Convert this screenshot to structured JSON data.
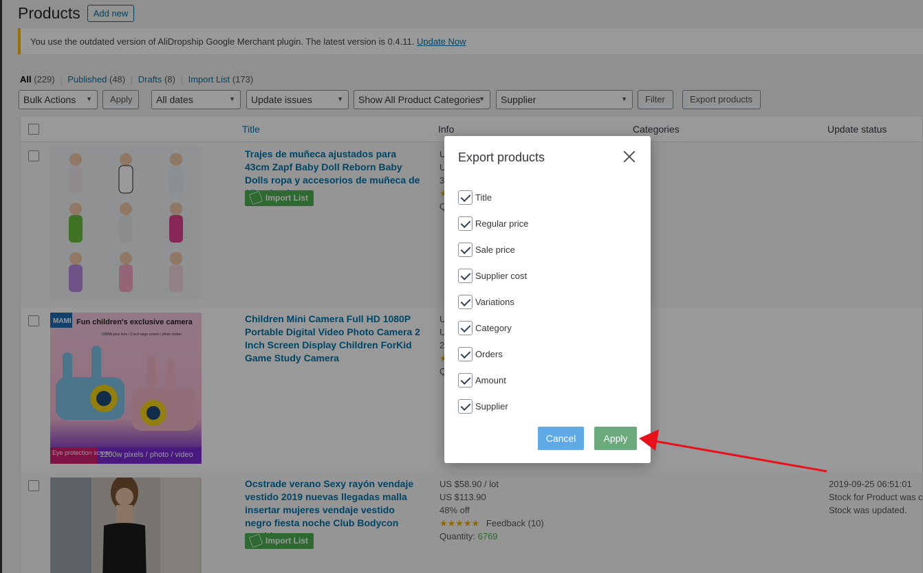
{
  "header": {
    "title": "Products",
    "add_new": "Add new"
  },
  "notice": {
    "text": "You use the outdated version of AliDropship Google Merchant plugin. The latest version is 0.4.11.",
    "link": "Update Now"
  },
  "views": [
    {
      "label": "All",
      "count": "(229)"
    },
    {
      "label": "Published",
      "count": "(48)"
    },
    {
      "label": "Drafts",
      "count": "(8)"
    },
    {
      "label": "Import List",
      "count": "(173)"
    }
  ],
  "filters": {
    "bulk_actions": "Bulk Actions",
    "apply": "Apply",
    "dates": "All dates",
    "update_issues": "Update issues",
    "categories": "Show All Product Categories",
    "supplier": "Supplier",
    "filter": "Filter",
    "export": "Export products"
  },
  "columns": {
    "title": "Title",
    "info": "Info",
    "categories": "Categories",
    "update_status": "Update status"
  },
  "products": [
    {
      "title": "Trajes de muñeca ajustados para 43cm Zapf Baby Doll Reborn Baby Dolls ropa y accesorios de muñeca de 17 pulgadas",
      "import_label": "Import List",
      "info_partial": [
        "U",
        "U",
        "35",
        "Q"
      ]
    },
    {
      "title": "Children Mini Camera Full HD 1080P Portable Digital Video Photo Camera 2 Inch Screen Display Children ForKid Game Study Camera",
      "info_partial": [
        "U",
        "U",
        "25",
        "Q"
      ],
      "image_text": {
        "brand": "MAMI",
        "headline": "Fun children's exclusive camera",
        "sub": "1200W pixel lens / 2 inch large screen / photo sticker",
        "badge": "Eye protection screen",
        "footer": "1200w pixels / photo / video"
      }
    },
    {
      "title": "Ocstrade verano Sexy rayón vendaje vestido 2019 nuevas llegadas malla insertar mujeres vendaje vestido negro fiesta noche Club Bodycon vestido",
      "import_label": "Import List",
      "price": "US $58.90 / lot",
      "old_price": "US $113.90",
      "discount": "48% off",
      "stars": "★★★★★",
      "feedback": "Feedback (10)",
      "quantity_label": "Quantity:",
      "quantity": "6769",
      "update_date": "2019-09-25 06:51:01",
      "update_line1": "Stock for Product was ch",
      "update_line2": "Stock was updated."
    }
  ],
  "modal": {
    "title": "Export products",
    "options": [
      "Title",
      "Regular price",
      "Sale price",
      "Supplier cost",
      "Variations",
      "Category",
      "Orders",
      "Amount",
      "Supplier"
    ],
    "cancel": "Cancel",
    "apply": "Apply"
  },
  "colors": {
    "accent": "#0073aa",
    "import_green": "#4caf50",
    "cancel_blue": "#5fa9e6",
    "arrow_red": "#e8101a"
  }
}
